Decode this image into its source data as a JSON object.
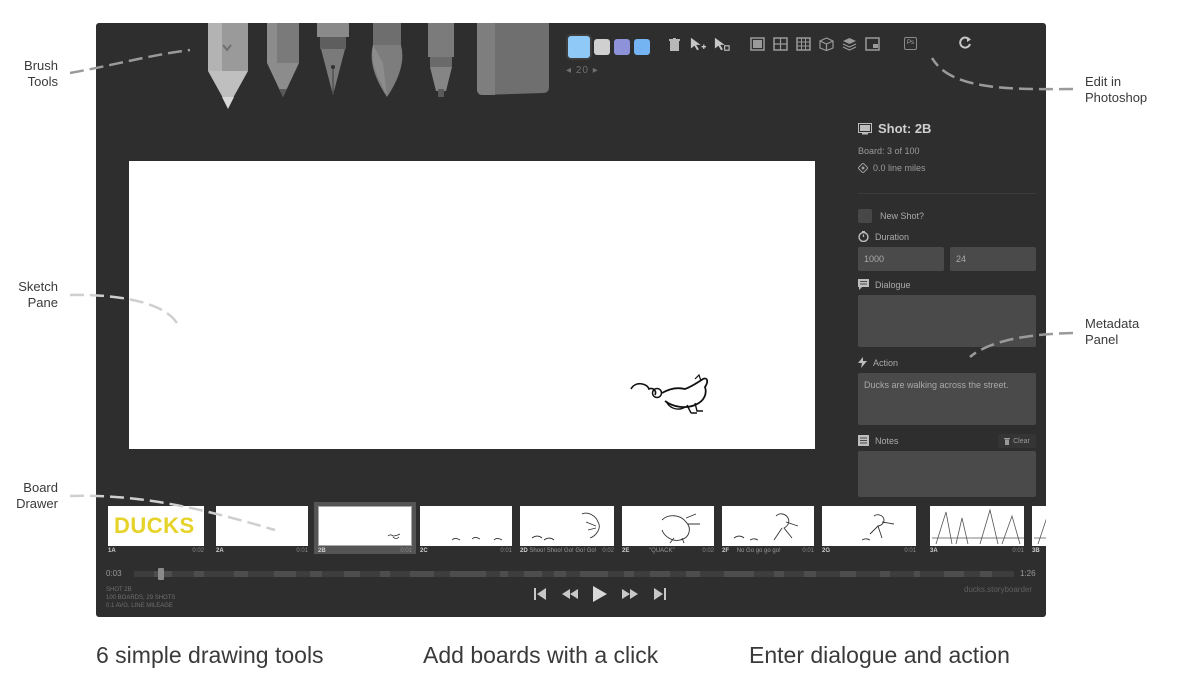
{
  "callouts": {
    "brush_tools": [
      "Brush",
      "Tools"
    ],
    "sketch_pane": [
      "Sketch",
      "Pane"
    ],
    "board_drawer": [
      "Board",
      "Drawer"
    ],
    "edit_in_photoshop": [
      "Edit in",
      "Photoshop"
    ],
    "metadata_panel": [
      "Metadata",
      "Panel"
    ]
  },
  "captions": [
    "6 simple drawing tools",
    "Add boards with a click",
    "Enter dialogue and action"
  ],
  "toolbar": {
    "brushes": [
      "light-pencil-icon",
      "pencil-icon",
      "pen-icon",
      "brush-icon",
      "note-pen-icon",
      "eraser-icon"
    ],
    "swatches": [
      "#8ec9f8",
      "#d0d0d0",
      "#8e92d8",
      "#74b4f2"
    ],
    "brush_size": "20",
    "ps_label": "Ps"
  },
  "meta": {
    "shot_title": "Shot: 2B",
    "board_info": "Board: 3 of 100",
    "line_miles": "0.0 line miles",
    "new_shot_label": "New Shot?",
    "duration_label": "Duration",
    "duration_ms": "1000",
    "duration_frames": "24",
    "dialogue_label": "Dialogue",
    "dialogue_value": "",
    "action_label": "Action",
    "action_value": "Ducks are walking across the street.",
    "notes_label": "Notes",
    "clear_label": "Clear",
    "notes_value": ""
  },
  "boards": [
    {
      "id": "1A",
      "dialogue": "",
      "duration": "0:02"
    },
    {
      "id": "2A",
      "dialogue": "",
      "duration": "0:01"
    },
    {
      "id": "2B",
      "dialogue": "",
      "duration": "0:01",
      "selected": true
    },
    {
      "id": "2C",
      "dialogue": "",
      "duration": "0:01"
    },
    {
      "id": "2D",
      "dialogue": "Shoo! Shoo! Go! Go! Go!",
      "duration": "0:02"
    },
    {
      "id": "2E",
      "dialogue": "\"QUACK\"",
      "duration": "0:02"
    },
    {
      "id": "2F",
      "dialogue": "No Go go go go!",
      "duration": "0:01"
    },
    {
      "id": "2G",
      "dialogue": "",
      "duration": "0:01"
    },
    {
      "id": "3A",
      "dialogue": "",
      "duration": "0:01"
    },
    {
      "id": "3B",
      "dialogue": "",
      "duration": ""
    }
  ],
  "board_1a_text": "DUCKS",
  "timeline": {
    "start": "0:03",
    "end": "1:26"
  },
  "stats": [
    "SHOT 2B",
    "100 BOARDS, 29 SHOTS",
    "0.1 AVG. LINE MILEAGE"
  ],
  "domain_label": "ducks.storyboarder"
}
